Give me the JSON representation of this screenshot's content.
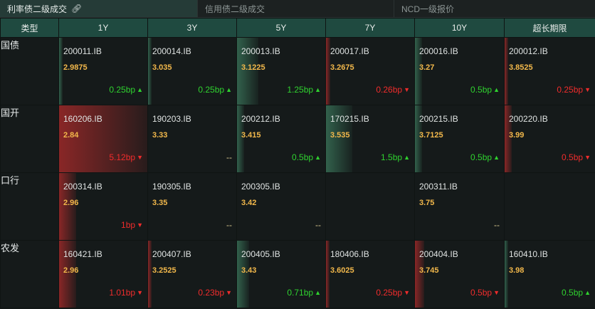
{
  "tabs": [
    {
      "label": "利率债二级成交",
      "active": true,
      "icon": "link-icon"
    },
    {
      "label": "信用债二级成交",
      "active": false
    },
    {
      "label": "NCD一级报价",
      "active": false
    }
  ],
  "columns": [
    "类型",
    "1Y",
    "3Y",
    "5Y",
    "7Y",
    "10Y",
    "超长期限"
  ],
  "rows": [
    {
      "type": "国债",
      "cells": [
        {
          "code": "200011.IB",
          "yield": "2.9875",
          "change": "0.25bp",
          "dir": "up",
          "bar": "green",
          "bar_level": 0.03
        },
        {
          "code": "200014.IB",
          "yield": "3.035",
          "change": "0.25bp",
          "dir": "up",
          "bar": "green",
          "bar_level": 0.03
        },
        {
          "code": "200013.IB",
          "yield": "3.1225",
          "change": "1.25bp",
          "dir": "up",
          "bar": "green",
          "bar_level": 0.24
        },
        {
          "code": "200017.IB",
          "yield": "3.2675",
          "change": "0.26bp",
          "dir": "down",
          "bar": "red",
          "bar_level": 0.05
        },
        {
          "code": "200016.IB",
          "yield": "3.27",
          "change": "0.5bp",
          "dir": "up",
          "bar": "green",
          "bar_level": 0.08
        },
        {
          "code": "200012.IB",
          "yield": "3.8525",
          "change": "0.25bp",
          "dir": "down",
          "bar": "red",
          "bar_level": 0.04
        }
      ]
    },
    {
      "type": "国开",
      "cells": [
        {
          "code": "160206.IB",
          "yield": "2.84",
          "change": "5.12bp",
          "dir": "down",
          "bar": "red",
          "bar_level": 1.0
        },
        {
          "code": "190203.IB",
          "yield": "3.33",
          "change": "--",
          "dir": "flat",
          "bar": "none",
          "bar_level": 0
        },
        {
          "code": "200212.IB",
          "yield": "3.415",
          "change": "0.5bp",
          "dir": "up",
          "bar": "green",
          "bar_level": 0.08
        },
        {
          "code": "170215.IB",
          "yield": "3.535",
          "change": "1.5bp",
          "dir": "up",
          "bar": "green",
          "bar_level": 0.3
        },
        {
          "code": "200215.IB",
          "yield": "3.7125",
          "change": "0.5bp",
          "dir": "up",
          "bar": "green",
          "bar_level": 0.08
        },
        {
          "code": "200220.IB",
          "yield": "3.99",
          "change": "0.5bp",
          "dir": "down",
          "bar": "red",
          "bar_level": 0.08
        }
      ]
    },
    {
      "type": "口行",
      "cells": [
        {
          "code": "200314.IB",
          "yield": "2.96",
          "change": "1bp",
          "dir": "down",
          "bar": "red",
          "bar_level": 0.19
        },
        {
          "code": "190305.IB",
          "yield": "3.35",
          "change": "--",
          "dir": "flat",
          "bar": "none",
          "bar_level": 0
        },
        {
          "code": "200305.IB",
          "yield": "3.42",
          "change": "--",
          "dir": "flat",
          "bar": "none",
          "bar_level": 0
        },
        {
          "code": "",
          "yield": "",
          "change": "",
          "dir": "none",
          "bar": "none",
          "bar_level": 0
        },
        {
          "code": "200311.IB",
          "yield": "3.75",
          "change": "--",
          "dir": "flat",
          "bar": "none",
          "bar_level": 0
        },
        {
          "code": "",
          "yield": "",
          "change": "",
          "dir": "none",
          "bar": "none",
          "bar_level": 0
        }
      ]
    },
    {
      "type": "农发",
      "cells": [
        {
          "code": "160421.IB",
          "yield": "2.96",
          "change": "1.01bp",
          "dir": "down",
          "bar": "red",
          "bar_level": 0.19
        },
        {
          "code": "200407.IB",
          "yield": "3.2525",
          "change": "0.23bp",
          "dir": "down",
          "bar": "red",
          "bar_level": 0.03
        },
        {
          "code": "200405.IB",
          "yield": "3.43",
          "change": "0.71bp",
          "dir": "up",
          "bar": "green",
          "bar_level": 0.14
        },
        {
          "code": "180406.IB",
          "yield": "3.6025",
          "change": "0.25bp",
          "dir": "down",
          "bar": "red",
          "bar_level": 0.04
        },
        {
          "code": "200404.IB",
          "yield": "3.745",
          "change": "0.5bp",
          "dir": "down",
          "bar": "red",
          "bar_level": 0.1
        },
        {
          "code": "160410.IB",
          "yield": "3.98",
          "change": "0.5bp",
          "dir": "up",
          "bar": "green",
          "bar_level": 0.04
        }
      ]
    }
  ],
  "colors": {
    "up": "#2fd22f",
    "down": "#f02c2c",
    "yield": "#f2b84b",
    "header_bg": "#1f4a40"
  }
}
